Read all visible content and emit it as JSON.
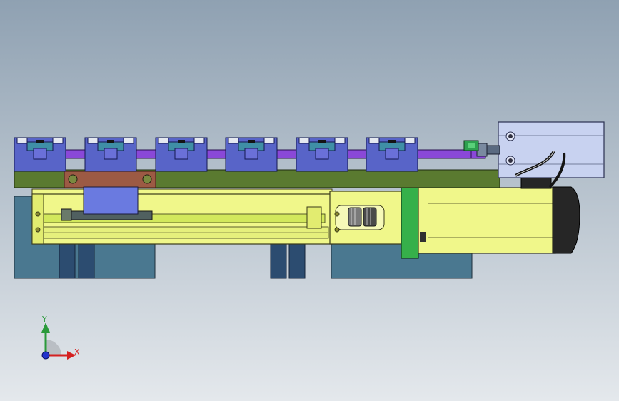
{
  "viewport": {
    "background_top": "#8fa1b2",
    "background_bottom": "#e4e8ec"
  },
  "axes": {
    "x_label": "X",
    "y_label": "Y",
    "x_color": "#d42020",
    "y_color": "#2a9a3a",
    "z_color": "#2233cc"
  },
  "colors": {
    "carrier_block": "#5864c8",
    "carrier_slot": "#3f8fa6",
    "rail_purple": "#8a48d8",
    "base_plate": "#5a7a30",
    "slider_plate": "#9c5a44",
    "actuator_yellow": "#f0f78a",
    "actuator_green": "#d2e85c",
    "motor_flange": "#36b04a",
    "motor_cap": "#262626",
    "cylinder_body": "#c8d2f0",
    "fitting_green": "#2ea050",
    "support_steel": "#4a7890",
    "support_rib": "#2c4c70"
  },
  "icons": {
    "coordinate_triad": "xyz-triad-icon"
  }
}
